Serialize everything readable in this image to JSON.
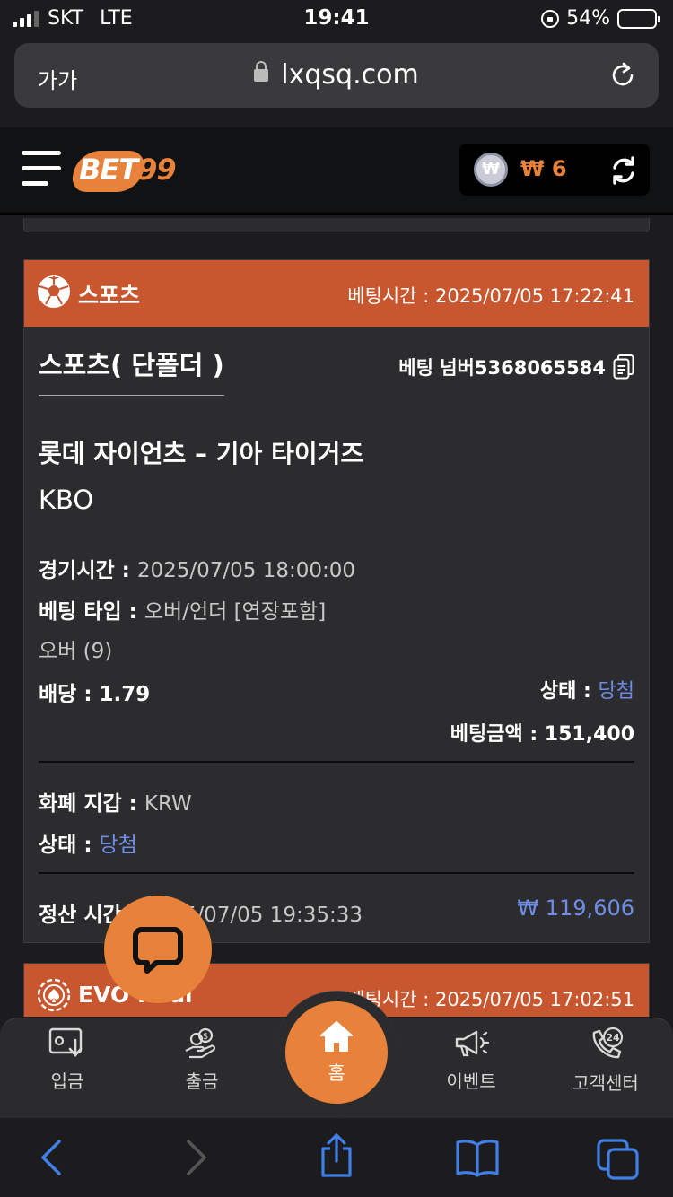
{
  "status_bar": {
    "carrier": "SKT",
    "network": "LTE",
    "time": "19:41",
    "battery": "54%",
    "battery_level": 0.54
  },
  "browser": {
    "text_size_label": "가가",
    "host": "lxqsq.com"
  },
  "header": {
    "logo_text": "BET",
    "logo_num": "99",
    "wallet_symbol": "₩",
    "wallet_balance": "₩ 6",
    "accent_color": "#e8823a"
  },
  "bet_card": {
    "category": "스포츠",
    "bet_time_label": "베팅시간 : ",
    "bet_time": "2025/07/05 17:22:41",
    "bet_type": "스포츠( 단폴더 )",
    "bet_number": "베팅 넘버5368065584",
    "match": "롯데 자이언츠 – 기아 타이거즈",
    "league": "KBO",
    "game_time_label": "경기시간 : ",
    "game_time": "2025/07/05 18:00:00",
    "bet_market_label": "베팅 타입 : ",
    "bet_market": "오버/언더 [연장포함]",
    "selection": "오버 (9)",
    "odds_label": "배당 : ",
    "odds": "1.79",
    "status_label": "상태 : ",
    "status": "당첨",
    "stake_label": "베팅금액 : ",
    "stake": "151,400",
    "currency_label": "화폐 지갑 : ",
    "currency": "KRW",
    "status2_label": "상태 : ",
    "status2": "당첨",
    "settle_label": "정산 시간 : ",
    "settle_time": "2025/07/05 19:35:33",
    "payout": "₩ 119,606",
    "header_color": "#c8572f",
    "win_color": "#6c8ee8"
  },
  "next_card": {
    "category": "EVO Real",
    "bet_time_label": "베팅시간 : ",
    "bet_time": "2025/07/05 17:02:51"
  },
  "bottom_nav": {
    "deposit": "입금",
    "withdraw": "출금",
    "home": "홈",
    "event": "이벤트",
    "support": "고객센터",
    "support_badge": "24"
  }
}
